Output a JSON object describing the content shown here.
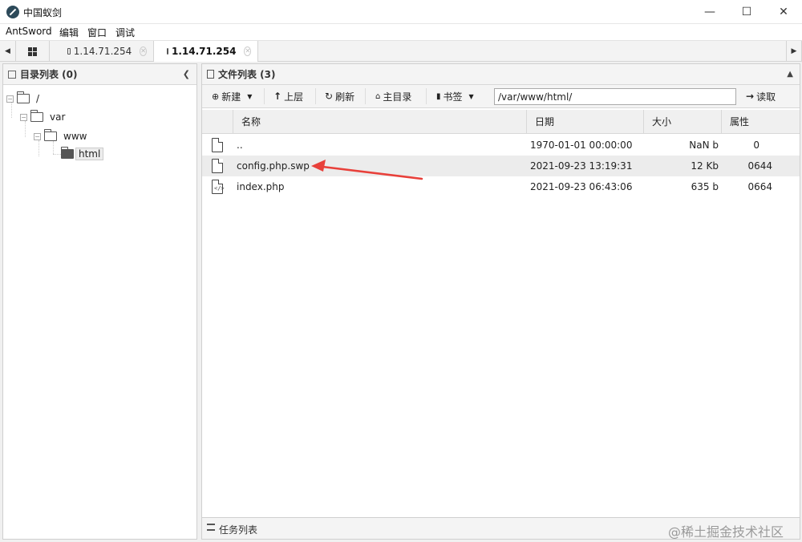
{
  "window": {
    "title": "中国蚁剑",
    "minimize": "—",
    "maximize": "☐",
    "close": "✕"
  },
  "menu": [
    "AntSword",
    "编辑",
    "窗口",
    "调试"
  ],
  "tabs": [
    {
      "label": "1.14.71.254",
      "active": false
    },
    {
      "label": "1.14.71.254",
      "active": true
    }
  ],
  "left_panel": {
    "title": "目录列表 (0)",
    "tree": [
      {
        "label": "/"
      },
      {
        "label": "var"
      },
      {
        "label": "www"
      },
      {
        "label": "html"
      }
    ]
  },
  "right_panel": {
    "title": "文件列表 (3)",
    "toolbar": {
      "new": "新建",
      "up": "上层",
      "refresh": "刷新",
      "home": "主目录",
      "bookmark": "书签",
      "path": "/var/www/html/",
      "read": "读取"
    },
    "columns": [
      "名称",
      "日期",
      "大小",
      "属性"
    ],
    "files": [
      {
        "name": "..",
        "date": "1970-01-01 00:00:00",
        "size": "NaN b",
        "attr": "0"
      },
      {
        "name": "config.php.swp",
        "date": "2021-09-23 13:19:31",
        "size": "12 Kb",
        "attr": "0644"
      },
      {
        "name": "index.php",
        "date": "2021-09-23 06:43:06",
        "size": "635 b",
        "attr": "0664"
      }
    ]
  },
  "task_panel": {
    "title": "任务列表"
  },
  "watermark": "@稀土掘金技术社区",
  "colors": {
    "annotation_arrow": "#e8403a",
    "selected_row": "#ececec"
  }
}
